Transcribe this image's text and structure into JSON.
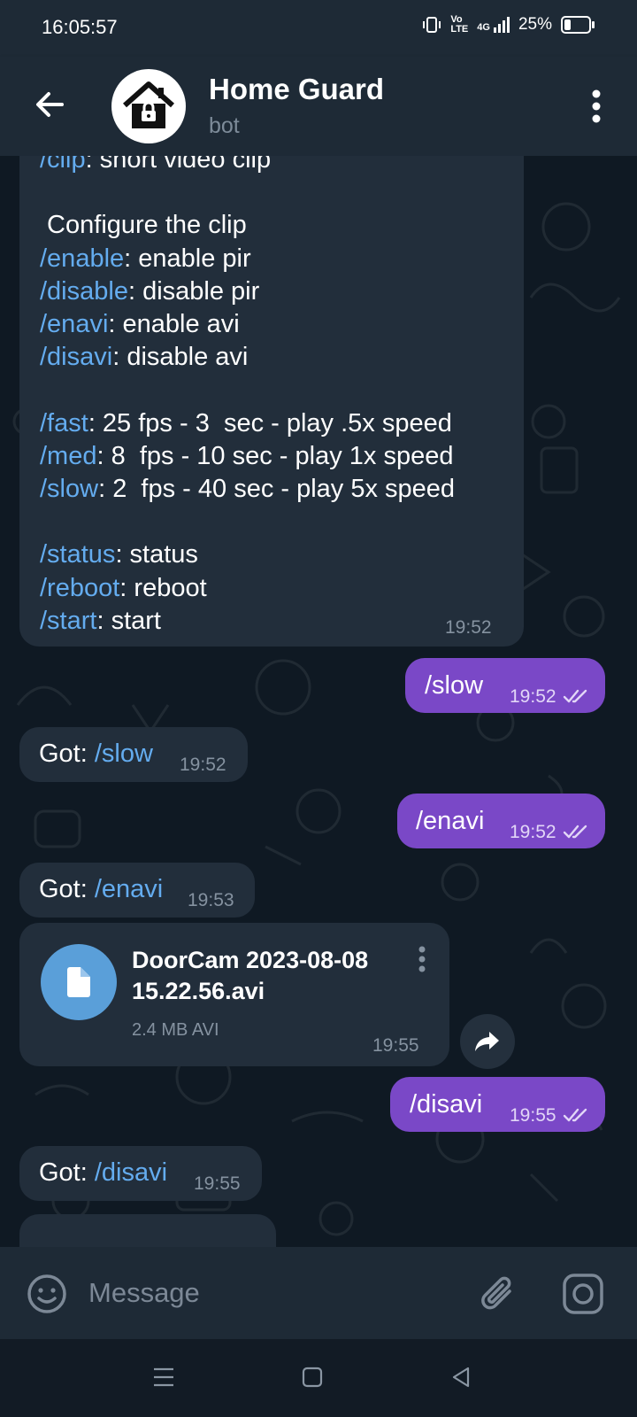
{
  "status_bar": {
    "time": "16:05:57",
    "volte": "Vo\nLTE",
    "network": "4G",
    "battery_percent": "25%",
    "battery_level": 0.25
  },
  "header": {
    "title": "Home Guard",
    "subtitle": "bot"
  },
  "help_message": {
    "lines": [
      {
        "cmd": "/clip",
        "text": ": short video clip"
      },
      {
        "cmd": "",
        "text": ""
      },
      {
        "cmd": "",
        "text": " Configure the clip"
      },
      {
        "cmd": "/enable",
        "text": ": enable pir"
      },
      {
        "cmd": "/disable",
        "text": ": disable pir"
      },
      {
        "cmd": "/enavi",
        "text": ": enable avi"
      },
      {
        "cmd": "/disavi",
        "text": ": disable avi"
      },
      {
        "cmd": "",
        "text": ""
      },
      {
        "cmd": "/fast",
        "text": ": 25 fps - 3  sec - play .5x speed"
      },
      {
        "cmd": "/med",
        "text": ": 8  fps - 10 sec - play 1x speed"
      },
      {
        "cmd": "/slow",
        "text": ": 2  fps - 40 sec - play 5x speed"
      },
      {
        "cmd": "",
        "text": ""
      },
      {
        "cmd": "/status",
        "text": ": status"
      },
      {
        "cmd": "/reboot",
        "text": ": reboot"
      },
      {
        "cmd": "/start",
        "text": ": start"
      }
    ],
    "time": "19:52"
  },
  "messages": {
    "out_slow": {
      "text": "/slow",
      "time": "19:52"
    },
    "in_slow": {
      "prefix": "Got: ",
      "cmd": "/slow",
      "time": "19:52"
    },
    "out_enavi": {
      "text": "/enavi",
      "time": "19:52"
    },
    "in_enavi": {
      "prefix": "Got: ",
      "cmd": "/enavi",
      "time": "19:53"
    },
    "file": {
      "name_line1": "DoorCam 2023-08-08",
      "name_line2": "15.22.56.avi",
      "meta": "2.4 MB AVI",
      "time": "19:55"
    },
    "out_disavi": {
      "text": "/disavi",
      "time": "19:55"
    },
    "in_disavi": {
      "prefix": "Got: ",
      "cmd": "/disavi",
      "time": "19:55"
    }
  },
  "input": {
    "placeholder": "Message"
  },
  "colors": {
    "outgoing_bubble": "#7a48c7",
    "incoming_bubble": "#222e3b",
    "command_link": "#64acef",
    "file_icon": "#5a9fd9"
  }
}
